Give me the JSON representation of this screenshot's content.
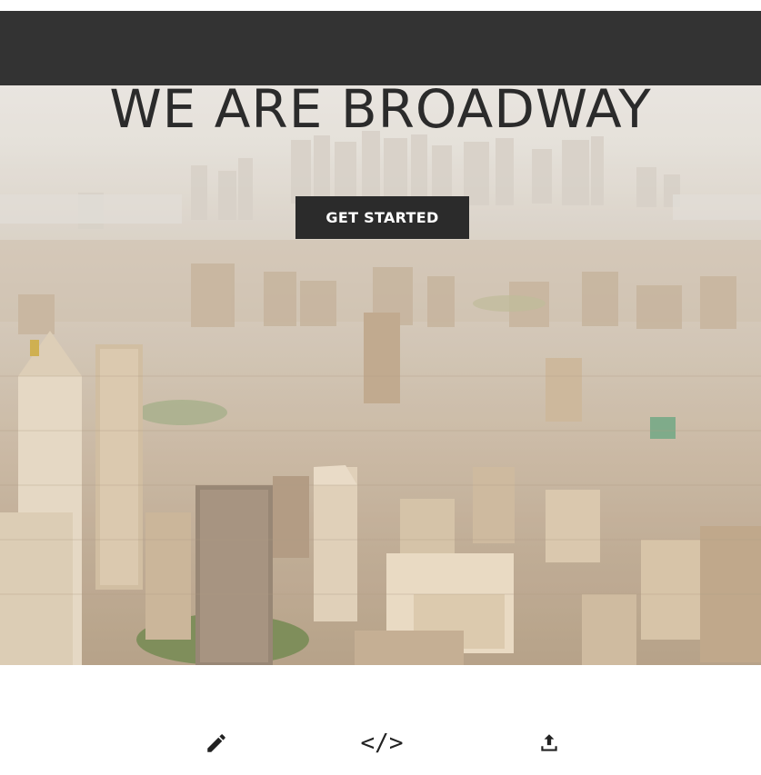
{
  "hero": {
    "title": "WE ARE BROADWAY",
    "cta_label": "GET STARTED"
  },
  "features": {
    "icons": [
      {
        "name": "pencil-icon"
      },
      {
        "name": "code-icon",
        "glyph": "</>"
      },
      {
        "name": "upload-icon"
      }
    ]
  },
  "colors": {
    "header_bar": "#333333",
    "button_bg": "#2b2b2b",
    "button_text": "#ffffff",
    "title_text": "#2b2b2b"
  }
}
